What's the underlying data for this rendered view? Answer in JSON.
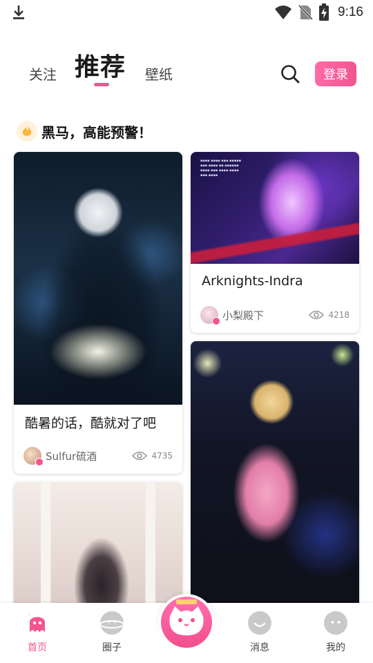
{
  "status_bar": {
    "time": "9:16",
    "icons": [
      "download-icon",
      "wifi-icon",
      "no-sim-icon",
      "battery-charging-icon"
    ]
  },
  "header": {
    "tabs": [
      {
        "label": "关注",
        "active": false
      },
      {
        "label": "推荐",
        "active": true
      },
      {
        "label": "壁纸",
        "active": false
      }
    ],
    "search_icon": "search-icon",
    "login_label": "登录"
  },
  "section": {
    "icon": "fire-icon",
    "title": "黑马，高能预警！"
  },
  "cards": [
    {
      "title": "酷暑的话，酷就对了吧",
      "author": "Sulfur硫酒",
      "views": "4735"
    },
    {
      "title": "Arknights-Indra",
      "author": "小梨殿下",
      "views": "4218"
    }
  ],
  "bottom_nav": {
    "items": [
      {
        "label": "首页",
        "icon": "ghost-home-icon",
        "active": true
      },
      {
        "label": "圈子",
        "icon": "planet-icon",
        "active": false
      },
      {
        "label": "",
        "icon": "cat-create-icon",
        "active": false
      },
      {
        "label": "消息",
        "icon": "chat-bubble-icon",
        "active": false
      },
      {
        "label": "我的",
        "icon": "profile-face-icon",
        "active": false
      }
    ]
  },
  "colors": {
    "accent": "#f2558f",
    "text": "#1c1c1c",
    "muted": "#888888"
  }
}
